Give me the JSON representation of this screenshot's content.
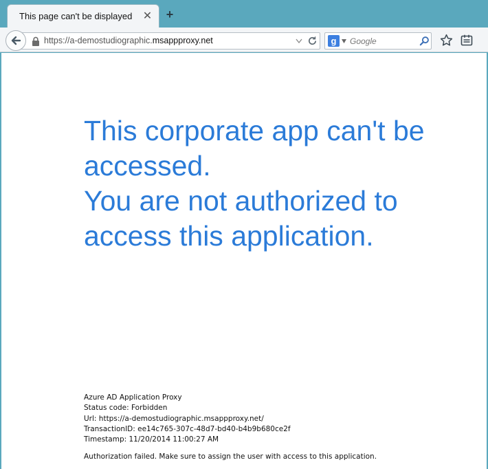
{
  "tab": {
    "title": "This page can't be displayed",
    "close_glyph": "✕",
    "new_tab_glyph": "+"
  },
  "toolbar": {
    "url_prefix": "https://a-demostudiographic.",
    "url_domain": "msappproxy.net",
    "search_engine_glyph": "g",
    "search_placeholder": "Google"
  },
  "page": {
    "headline_line1": "This corporate app can't be accessed.",
    "headline_line2": "You are not authorized to access this application.",
    "details": [
      "Azure AD Application Proxy",
      "Status code: Forbidden",
      "Url: https://a-demostudiographic.msappproxy.net/",
      "TransactionID: ee14c765-307c-48d7-bd40-b4b9b680ce2f",
      "Timestamp: 11/20/2014 11:00:27 AM"
    ],
    "auth_message": "Authorization failed. Make sure to assign the user with access to this application."
  },
  "colors": {
    "headline": "#2b7bd8",
    "tabstrip": "#5aa8bd",
    "toolbar": "#f3f5f7"
  },
  "icons": [
    "back-arrow-icon",
    "lock-icon",
    "dropdown-arrow-icon",
    "reload-icon",
    "google-icon",
    "search-icon",
    "star-icon",
    "reading-list-icon",
    "close-icon",
    "plus-icon"
  ]
}
